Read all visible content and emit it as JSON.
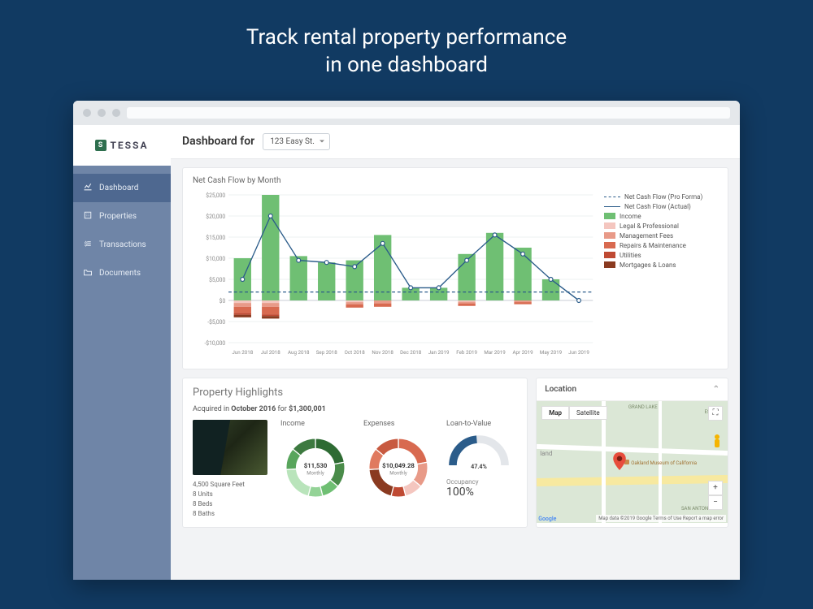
{
  "hero": {
    "line1": "Track rental property performance",
    "line2": "in one dashboard"
  },
  "brand": {
    "name": "TESSA",
    "badge": "S"
  },
  "sidebar": {
    "items": [
      {
        "label": "Dashboard",
        "icon": "chart-line-icon",
        "active": true
      },
      {
        "label": "Properties",
        "icon": "building-icon",
        "active": false
      },
      {
        "label": "Transactions",
        "icon": "money-icon",
        "active": false
      },
      {
        "label": "Documents",
        "icon": "folder-icon",
        "active": false
      }
    ]
  },
  "header": {
    "title_prefix": "Dashboard for",
    "property_selected": "123 Easy St."
  },
  "chart_card": {
    "title": "Net Cash Flow by Month"
  },
  "chart_data": {
    "type": "bar",
    "title": "Net Cash Flow by Month",
    "xlabel": "",
    "ylabel": "",
    "ylim": [
      -10000,
      25000
    ],
    "yticks": [
      -10000,
      -5000,
      0,
      5000,
      10000,
      15000,
      20000,
      25000
    ],
    "ytick_labels": [
      "-$10,000",
      "-$5,000",
      "$0",
      "$5,000",
      "$10,000",
      "$15,000",
      "$20,000",
      "$25,000"
    ],
    "categories": [
      "Jun 2018",
      "Jul 2018",
      "Aug 2018",
      "Sep 2018",
      "Oct 2018",
      "Nov 2018",
      "Dec 2018",
      "Jan 2019",
      "Feb 2019",
      "Mar 2019",
      "Apr 2019",
      "May 2019",
      "Jun 2019"
    ],
    "pro_forma_level": 2000,
    "series": [
      {
        "name": "Income",
        "color": "#6fbf73",
        "values": [
          10000,
          25000,
          10500,
          9000,
          9500,
          15500,
          3000,
          3000,
          11000,
          16000,
          12500,
          5000,
          0
        ]
      },
      {
        "name": "Legal & Professional",
        "color": "#f4c6bf",
        "values": [
          -600,
          -600,
          0,
          0,
          -400,
          0,
          0,
          0,
          -300,
          0,
          0,
          0,
          0
        ]
      },
      {
        "name": "Management Fees",
        "color": "#e89a88",
        "values": [
          -900,
          -900,
          0,
          0,
          -500,
          -700,
          0,
          0,
          -400,
          0,
          -400,
          0,
          0
        ]
      },
      {
        "name": "Repairs & Maintenance",
        "color": "#d86a50",
        "values": [
          -1500,
          -1800,
          0,
          0,
          -800,
          -800,
          0,
          0,
          -600,
          0,
          -500,
          0,
          0
        ]
      },
      {
        "name": "Utilities",
        "color": "#bf4a33",
        "values": [
          -400,
          -400,
          0,
          0,
          0,
          0,
          0,
          0,
          0,
          0,
          0,
          0,
          0
        ]
      },
      {
        "name": "Mortgages & Loans",
        "color": "#8a3a20",
        "values": [
          -600,
          -600,
          0,
          0,
          0,
          0,
          0,
          0,
          0,
          0,
          0,
          0,
          0
        ]
      }
    ],
    "net_actual": [
      5000,
      20000,
      9500,
      9000,
      8000,
      13500,
      3000,
      3000,
      9500,
      15500,
      11000,
      5000,
      0
    ],
    "legend": [
      {
        "label": "Net Cash Flow (Pro Forma)",
        "style": "dash"
      },
      {
        "label": "Net Cash Flow (Actual)",
        "style": "line"
      },
      {
        "label": "Income",
        "color": "#6fbf73"
      },
      {
        "label": "Legal & Professional",
        "color": "#f4c6bf"
      },
      {
        "label": "Management Fees",
        "color": "#e89a88"
      },
      {
        "label": "Repairs & Maintenance",
        "color": "#d86a50"
      },
      {
        "label": "Utilities",
        "color": "#bf4a33"
      },
      {
        "label": "Mortgages & Loans",
        "color": "#8a3a20"
      }
    ]
  },
  "highlights": {
    "title": "Property Highlights",
    "acquired_prefix": "Acquired in ",
    "acquired_date": "October 2016",
    "acquired_mid": " for ",
    "acquired_price": "$1,300,001",
    "facts": [
      "4,500 Square Feet",
      "8 Units",
      "8 Beds",
      "8 Baths"
    ],
    "income": {
      "label": "Income",
      "value": "$11,530",
      "sub": "Monthly"
    },
    "expenses": {
      "label": "Expenses",
      "value": "$10,049.28",
      "sub": "Monthly"
    },
    "ltv": {
      "label": "Loan-to-Value",
      "value_pct": 47.4,
      "value_label": "47.4%"
    },
    "occupancy": {
      "label": "Occupancy",
      "value": "100%"
    }
  },
  "location": {
    "title": "Location",
    "map_tab": "Map",
    "sat_tab": "Satellite",
    "areas": [
      "GRAND LAKE",
      "ESHORE",
      "SAN ANTONIO"
    ],
    "poi": "Oakland Museum of California",
    "city": "land",
    "attribution": "Map data ©2019 Google   Terms of Use   Report a map error"
  }
}
